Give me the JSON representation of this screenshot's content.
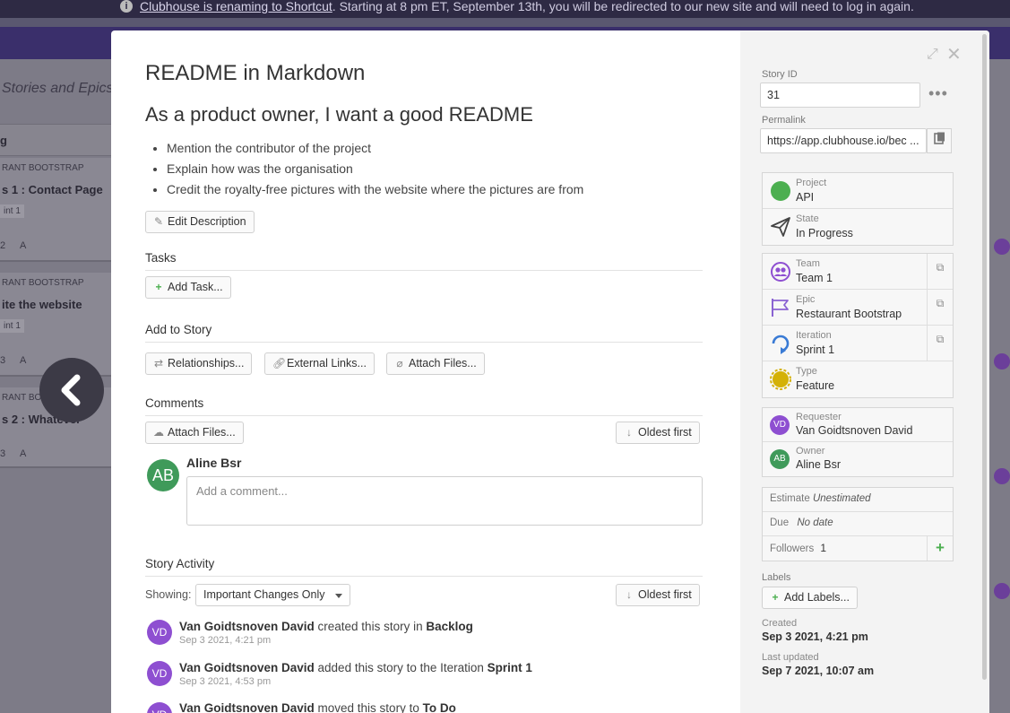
{
  "banner": {
    "link_text": "Clubhouse is renaming to Shortcut",
    "message": ". Starting at 8 pm ET, September 13th, you will be redirected to our new site and will need to log in again."
  },
  "background": {
    "page_title": "Stories and Epics",
    "column_head": "g",
    "cards": [
      {
        "epic": "RANT BOOTSTRAP",
        "title": "s 1 : Contact Page",
        "chip": "int 1",
        "foot": "A",
        "num": "2"
      },
      {
        "epic": "RANT BOOTSTRAP",
        "title": "ite the website",
        "chip": "int 1",
        "foot": "A",
        "num": "3"
      },
      {
        "epic": "RANT BOOTSTRAP",
        "title": "s 2 : Whatever",
        "chip": "",
        "foot": "A",
        "num": "3"
      }
    ]
  },
  "story": {
    "title": "README in Markdown",
    "heading": "As a product owner, I want a good README",
    "bullets": [
      "Mention the contributor of the project",
      "Explain how was the organisation",
      "Credit the royalty-free pictures with the website where the pictures are from"
    ],
    "edit_description": "Edit Description",
    "tasks_label": "Tasks",
    "add_task": "Add Task...",
    "add_to_story_label": "Add to Story",
    "relationships": "Relationships...",
    "external_links": "External Links...",
    "attach_files": "Attach Files...",
    "comments_label": "Comments",
    "comments_attach": "Attach Files...",
    "oldest_first": "Oldest first",
    "commenter_initials": "AB",
    "commenter_name": "Aline Bsr",
    "comment_placeholder": "Add a comment...",
    "activity_label": "Story Activity",
    "showing_label": "Showing:",
    "showing_value": "Important Changes Only",
    "activity_oldest": "Oldest first",
    "activity": [
      {
        "initials": "VD",
        "actor": "Van Goidtsnoven David",
        "action": " created this story in ",
        "target": "Backlog",
        "time": "Sep 3 2021, 4:21 pm"
      },
      {
        "initials": "VD",
        "actor": "Van Goidtsnoven David",
        "action": " added this story to the Iteration ",
        "target": "Sprint 1",
        "time": "Sep 3 2021, 4:53 pm"
      },
      {
        "initials": "VD",
        "actor": "Van Goidtsnoven David",
        "action": " moved this story to ",
        "target": "To Do",
        "time": ""
      }
    ]
  },
  "sidebar": {
    "story_id_label": "Story ID",
    "story_id": "31",
    "permalink_label": "Permalink",
    "permalink": "https://app.clubhouse.io/bec ...",
    "project_label": "Project",
    "project": "API",
    "state_label": "State",
    "state": "In Progress",
    "team_label": "Team",
    "team": "Team 1",
    "epic_label": "Epic",
    "epic": "Restaurant Bootstrap",
    "iteration_label": "Iteration",
    "iteration": "Sprint 1",
    "type_label": "Type",
    "type": "Feature",
    "requester_label": "Requester",
    "requester_initials": "VD",
    "requester": "Van Goidtsnoven David",
    "owner_label": "Owner",
    "owner_initials": "AB",
    "owner": "Aline Bsr",
    "estimate_label": "Estimate",
    "estimate": "Unestimated",
    "due_label": "Due",
    "due": "No date",
    "followers_label": "Followers",
    "followers": "1",
    "labels_label": "Labels",
    "add_labels": "Add Labels...",
    "created_label": "Created",
    "created": "Sep 3 2021, 4:21 pm",
    "updated_label": "Last updated",
    "updated": "Sep 7 2021, 10:07 am"
  },
  "colors": {
    "project_green": "#4caf50",
    "avatar_purple": "#8e4fd1",
    "avatar_green": "#3f9a5a",
    "feature_yellow": "#d4b106",
    "iteration_blue": "#3a7bd5"
  }
}
